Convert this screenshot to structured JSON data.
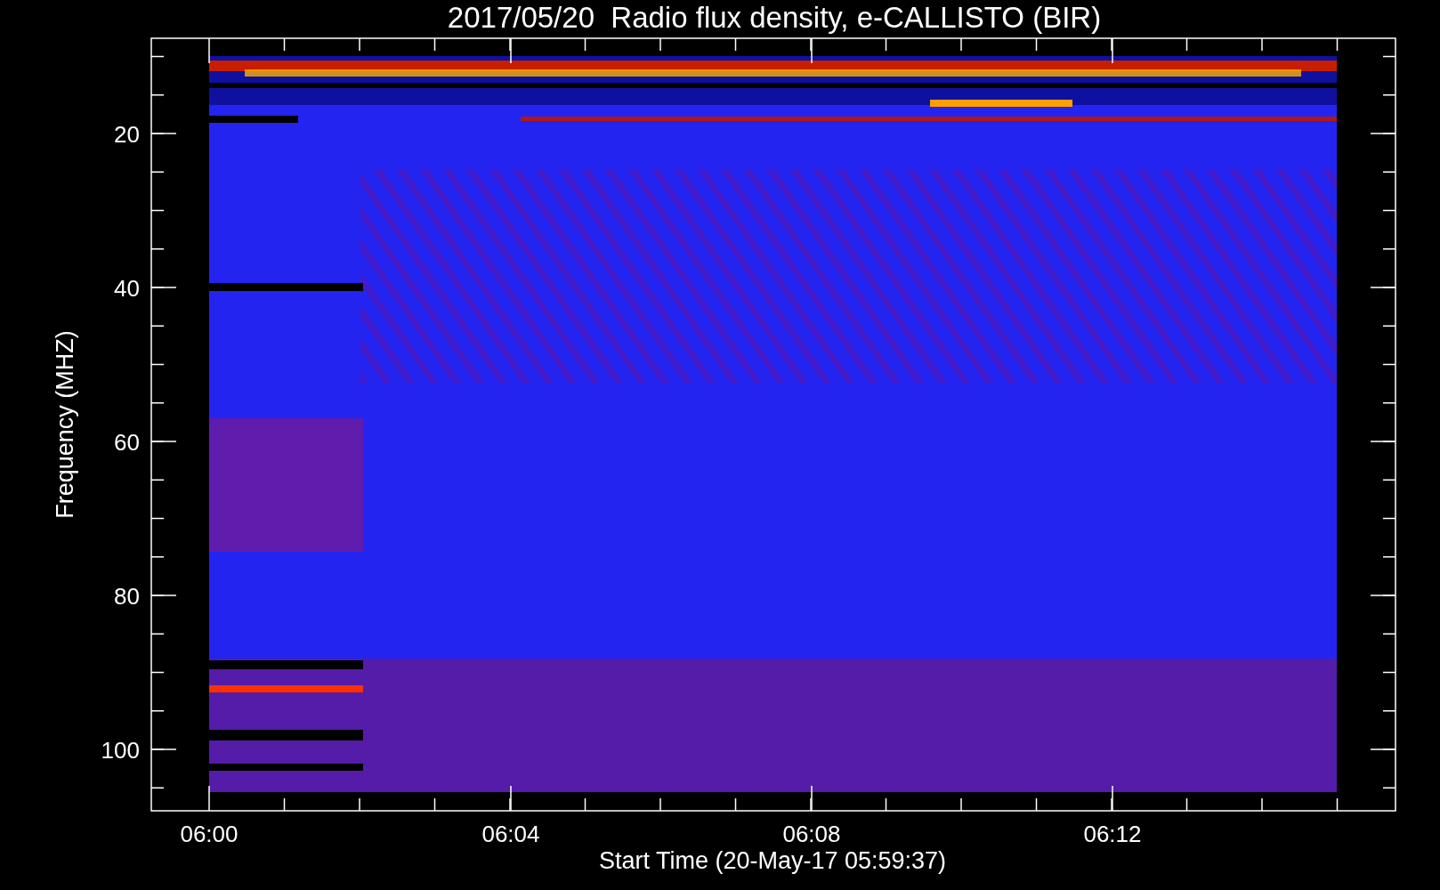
{
  "title": "2017/05/20  Radio flux density, e-CALLISTO (BIR)",
  "x_axis": {
    "label": "Start Time (20-May-17 05:59:37)",
    "ticks": [
      "06:00",
      "06:04",
      "06:08",
      "06:12"
    ]
  },
  "y_axis": {
    "label": "Frequency (MHZ)",
    "ticks": [
      "20",
      "40",
      "60",
      "80",
      "100"
    ]
  }
}
